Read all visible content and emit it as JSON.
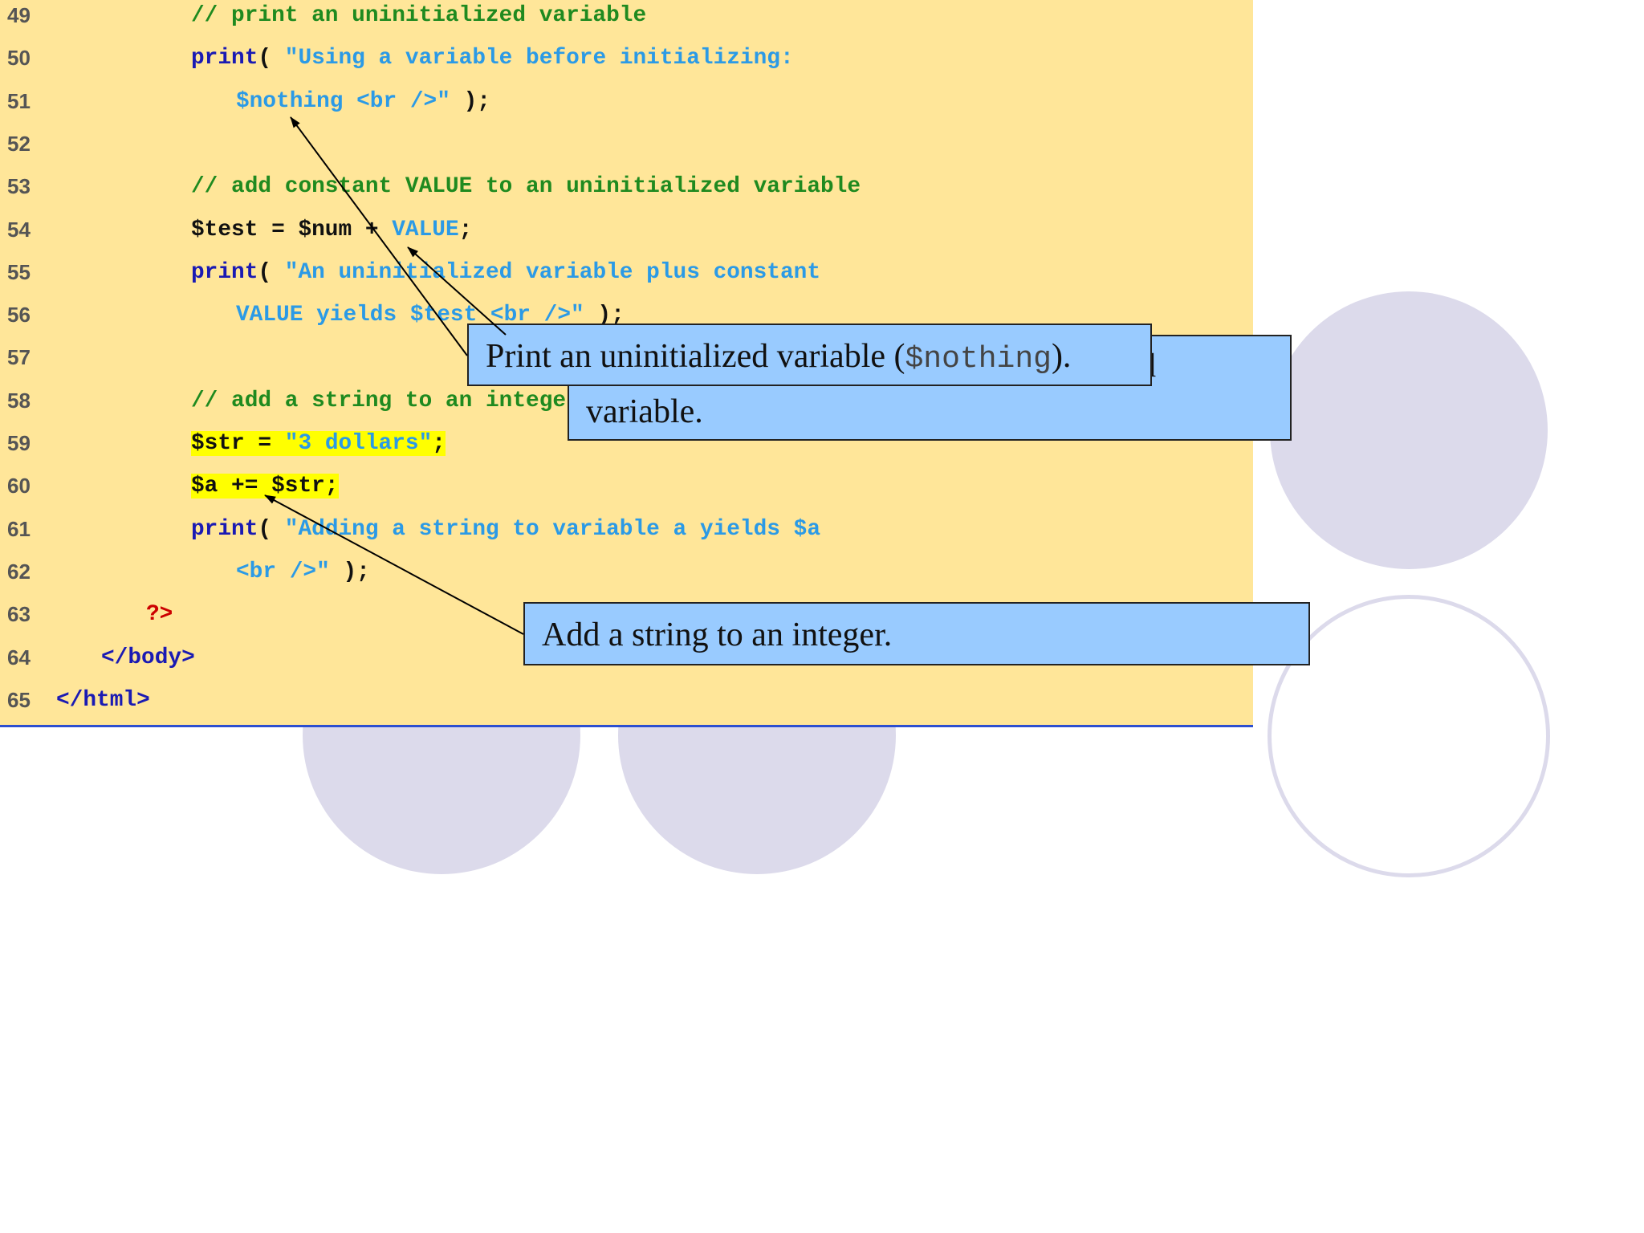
{
  "lines": [
    {
      "num": "49",
      "segments": [
        {
          "t": "// print an uninitialized variable",
          "c": "cm"
        }
      ]
    },
    {
      "num": "50",
      "segments": [
        {
          "t": "print",
          "c": "kw"
        },
        {
          "t": "( ",
          "c": "pl"
        },
        {
          "t": "\"Using a variable before initializing:",
          "c": "st"
        }
      ]
    },
    {
      "num": "51",
      "segments": [
        {
          "t": "$nothing <br />\"",
          "c": "st"
        },
        {
          "t": " );",
          "c": "pl"
        }
      ]
    },
    {
      "num": "52",
      "segments": []
    },
    {
      "num": "53",
      "segments": [
        {
          "t": "// add constant VALUE to an uninitialized variable",
          "c": "cm"
        }
      ]
    },
    {
      "num": "54",
      "segments": [
        {
          "t": "$test = $num + ",
          "c": "pl"
        },
        {
          "t": "VALUE",
          "c": "st"
        },
        {
          "t": ";",
          "c": "pl"
        }
      ]
    },
    {
      "num": "55",
      "segments": [
        {
          "t": "print",
          "c": "kw"
        },
        {
          "t": "( ",
          "c": "pl"
        },
        {
          "t": "\"An uninitialized variable plus constant",
          "c": "st"
        }
      ]
    },
    {
      "num": "56",
      "segments": [
        {
          "t": "VALUE yields $test <br />\"",
          "c": "st"
        },
        {
          "t": " );",
          "c": "pl"
        }
      ]
    },
    {
      "num": "57",
      "segments": []
    },
    {
      "num": "58",
      "segments": [
        {
          "t": "// add a string to an integer",
          "c": "cm"
        }
      ]
    },
    {
      "num": "59",
      "segments": [
        {
          "t": "$str = ",
          "c": "pl",
          "hl": true
        },
        {
          "t": "\"3 dollars\"",
          "c": "st",
          "hl": true
        },
        {
          "t": ";",
          "c": "pl",
          "hl": true
        }
      ]
    },
    {
      "num": "60",
      "segments": [
        {
          "t": "$a += $str;",
          "c": "pl",
          "hl": true
        }
      ]
    },
    {
      "num": "61",
      "segments": [
        {
          "t": "print",
          "c": "kw"
        },
        {
          "t": "( ",
          "c": "pl"
        },
        {
          "t": "\"Adding a string to variable a yields $a",
          "c": "st"
        }
      ]
    },
    {
      "num": "62",
      "segments": [
        {
          "t": "<br />\"",
          "c": "st"
        },
        {
          "t": " );",
          "c": "pl"
        }
      ]
    },
    {
      "num": "63",
      "segments": [
        {
          "t": "?>",
          "c": "rd"
        }
      ]
    },
    {
      "num": "64",
      "segments": [
        {
          "t": "</body>",
          "c": "kw"
        }
      ]
    },
    {
      "num": "65",
      "segments": [
        {
          "t": "</html>",
          "c": "kw"
        }
      ]
    }
  ],
  "callouts": {
    "print_uninit": {
      "prefix": "Print an uninitialized variable (",
      "code": "$nothing",
      "suffix": ")."
    },
    "add_constant": {
      "partial": "d",
      "line2": "variable."
    },
    "add_string": {
      "text": "Add a string to an integer."
    }
  }
}
